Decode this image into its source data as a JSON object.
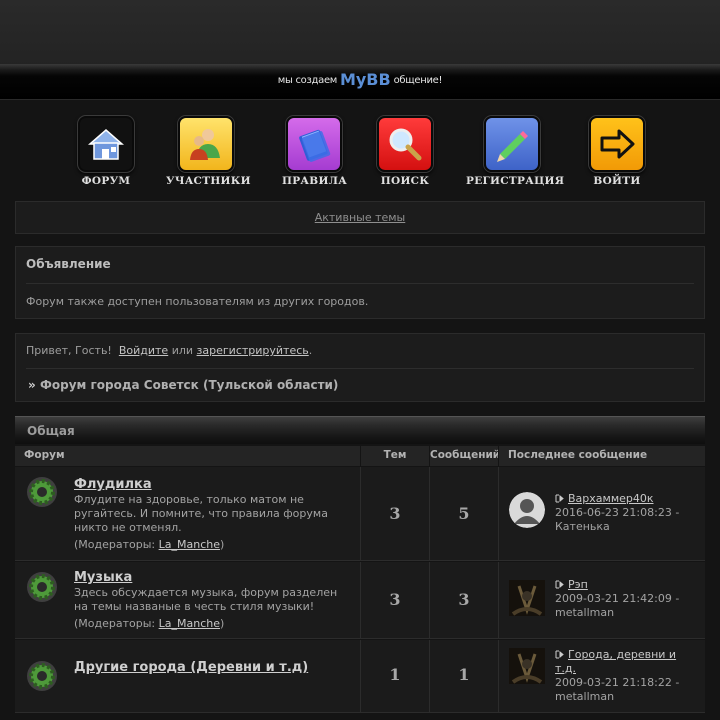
{
  "header": {
    "tagline_pre": "мы создаем",
    "tagline_brand": "MyBB",
    "tagline_post": "общение!"
  },
  "nav": [
    {
      "label": "ФОРУМ",
      "icon": "house-icon"
    },
    {
      "label": "УЧАСТНИКИ",
      "icon": "users-icon"
    },
    {
      "label": "ПРАВИЛА",
      "icon": "book-icon"
    },
    {
      "label": "ПОИСК",
      "icon": "magnifier-icon"
    },
    {
      "label": "РЕГИСТРАЦИЯ",
      "icon": "pencil-icon"
    },
    {
      "label": "ВОЙТИ",
      "icon": "login-arrow-icon"
    }
  ],
  "active_topics": "Активные темы",
  "announcement": {
    "title": "Объявление",
    "text": "Форум также доступен пользователям из других городов."
  },
  "welcome": {
    "greeting": "Привет, Гость!",
    "login": "Войдите",
    "or": "или",
    "register": "зарегистрируйтесь",
    "period": ".",
    "breadcrumb_sep": "»",
    "breadcrumb": "Форум города Советск (Тульской области)"
  },
  "category": {
    "title": "Общая",
    "columns": {
      "forum": "Форум",
      "topics": "Тем",
      "posts": "Сообщений",
      "last": "Последнее сообщение"
    },
    "forums": [
      {
        "title": "Флудилка",
        "desc": "Флудите на здоровье, только матом не ругайтесь. И помните, что правила форума никто не отменял.",
        "mods_label": "(Модераторы:",
        "mod": "La_Manche",
        "mods_end": ")",
        "topics": "3",
        "posts": "5",
        "last_topic": "Вархаммер40к",
        "last_date": "2016-06-23 21:08:23 -",
        "last_author": "Катенька",
        "avatar": "default-user-avatar"
      },
      {
        "title": "Музыка",
        "desc": "Здесь обсуждается музыка, форум разделен на темы названые в честь стиля музыки!",
        "mods_label": "(Модераторы:",
        "mod": "La_Manche",
        "mods_end": ")",
        "topics": "3",
        "posts": "3",
        "last_topic": "Рэп",
        "last_date": "2009-03-21 21:42:09 -",
        "last_author": "metallman",
        "avatar": "metallman-avatar"
      },
      {
        "title": "Другие города (Деревни и т.д)",
        "desc": "",
        "topics": "1",
        "posts": "1",
        "last_topic": "Города, деревни и т.д.",
        "last_date": "2009-03-21 21:18:22 -",
        "last_author": "metallman",
        "avatar": "metallman-avatar"
      }
    ]
  },
  "colors": {
    "background": "#141414",
    "panel": "#1c1c1c",
    "brand": "#5b8fd6"
  }
}
